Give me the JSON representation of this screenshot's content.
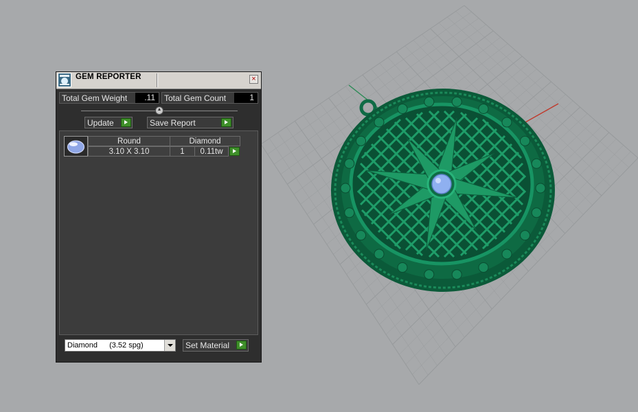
{
  "panel": {
    "title": "GEM REPORTER",
    "close_glyph": "×",
    "total_weight_label": "Total Gem Weight",
    "total_weight_value": ".11",
    "total_count_label": "Total Gem Count",
    "total_count_value": "1",
    "update_label": "Update",
    "save_report_label": "Save Report",
    "gems": [
      {
        "shape": "Round",
        "size": "3.10 X 3.10",
        "material": "Diamond",
        "count": "1",
        "weight": "0.11tw"
      }
    ],
    "material_select": {
      "name": "Diamond",
      "spg": "(3.52 spg)"
    },
    "set_material_label": "Set Material"
  },
  "viewport": {
    "object": "pendant-model",
    "colors": {
      "background": "#a7a9ab",
      "grid": "#9a9c9e",
      "model": "#0f6b45",
      "gem": "#8fb0f0",
      "axis_x": "#c0392b",
      "axis_y": "#2e8b57"
    }
  }
}
